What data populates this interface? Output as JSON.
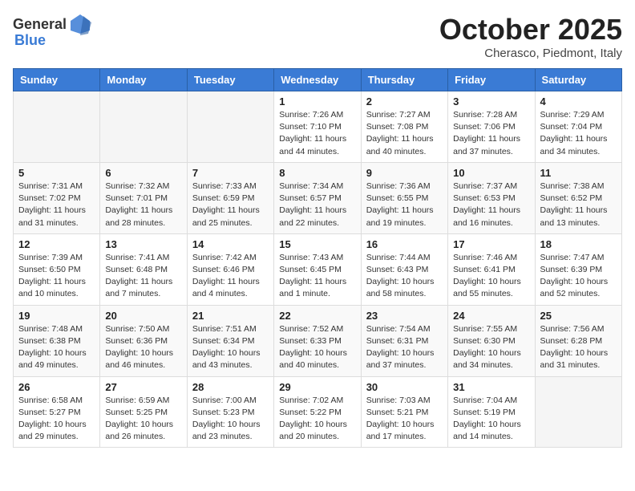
{
  "header": {
    "logo_general": "General",
    "logo_blue": "Blue",
    "month_title": "October 2025",
    "location": "Cherasco, Piedmont, Italy"
  },
  "weekdays": [
    "Sunday",
    "Monday",
    "Tuesday",
    "Wednesday",
    "Thursday",
    "Friday",
    "Saturday"
  ],
  "weeks": [
    [
      {
        "day": "",
        "detail": ""
      },
      {
        "day": "",
        "detail": ""
      },
      {
        "day": "",
        "detail": ""
      },
      {
        "day": "1",
        "detail": "Sunrise: 7:26 AM\nSunset: 7:10 PM\nDaylight: 11 hours\nand 44 minutes."
      },
      {
        "day": "2",
        "detail": "Sunrise: 7:27 AM\nSunset: 7:08 PM\nDaylight: 11 hours\nand 40 minutes."
      },
      {
        "day": "3",
        "detail": "Sunrise: 7:28 AM\nSunset: 7:06 PM\nDaylight: 11 hours\nand 37 minutes."
      },
      {
        "day": "4",
        "detail": "Sunrise: 7:29 AM\nSunset: 7:04 PM\nDaylight: 11 hours\nand 34 minutes."
      }
    ],
    [
      {
        "day": "5",
        "detail": "Sunrise: 7:31 AM\nSunset: 7:02 PM\nDaylight: 11 hours\nand 31 minutes."
      },
      {
        "day": "6",
        "detail": "Sunrise: 7:32 AM\nSunset: 7:01 PM\nDaylight: 11 hours\nand 28 minutes."
      },
      {
        "day": "7",
        "detail": "Sunrise: 7:33 AM\nSunset: 6:59 PM\nDaylight: 11 hours\nand 25 minutes."
      },
      {
        "day": "8",
        "detail": "Sunrise: 7:34 AM\nSunset: 6:57 PM\nDaylight: 11 hours\nand 22 minutes."
      },
      {
        "day": "9",
        "detail": "Sunrise: 7:36 AM\nSunset: 6:55 PM\nDaylight: 11 hours\nand 19 minutes."
      },
      {
        "day": "10",
        "detail": "Sunrise: 7:37 AM\nSunset: 6:53 PM\nDaylight: 11 hours\nand 16 minutes."
      },
      {
        "day": "11",
        "detail": "Sunrise: 7:38 AM\nSunset: 6:52 PM\nDaylight: 11 hours\nand 13 minutes."
      }
    ],
    [
      {
        "day": "12",
        "detail": "Sunrise: 7:39 AM\nSunset: 6:50 PM\nDaylight: 11 hours\nand 10 minutes."
      },
      {
        "day": "13",
        "detail": "Sunrise: 7:41 AM\nSunset: 6:48 PM\nDaylight: 11 hours\nand 7 minutes."
      },
      {
        "day": "14",
        "detail": "Sunrise: 7:42 AM\nSunset: 6:46 PM\nDaylight: 11 hours\nand 4 minutes."
      },
      {
        "day": "15",
        "detail": "Sunrise: 7:43 AM\nSunset: 6:45 PM\nDaylight: 11 hours\nand 1 minute."
      },
      {
        "day": "16",
        "detail": "Sunrise: 7:44 AM\nSunset: 6:43 PM\nDaylight: 10 hours\nand 58 minutes."
      },
      {
        "day": "17",
        "detail": "Sunrise: 7:46 AM\nSunset: 6:41 PM\nDaylight: 10 hours\nand 55 minutes."
      },
      {
        "day": "18",
        "detail": "Sunrise: 7:47 AM\nSunset: 6:39 PM\nDaylight: 10 hours\nand 52 minutes."
      }
    ],
    [
      {
        "day": "19",
        "detail": "Sunrise: 7:48 AM\nSunset: 6:38 PM\nDaylight: 10 hours\nand 49 minutes."
      },
      {
        "day": "20",
        "detail": "Sunrise: 7:50 AM\nSunset: 6:36 PM\nDaylight: 10 hours\nand 46 minutes."
      },
      {
        "day": "21",
        "detail": "Sunrise: 7:51 AM\nSunset: 6:34 PM\nDaylight: 10 hours\nand 43 minutes."
      },
      {
        "day": "22",
        "detail": "Sunrise: 7:52 AM\nSunset: 6:33 PM\nDaylight: 10 hours\nand 40 minutes."
      },
      {
        "day": "23",
        "detail": "Sunrise: 7:54 AM\nSunset: 6:31 PM\nDaylight: 10 hours\nand 37 minutes."
      },
      {
        "day": "24",
        "detail": "Sunrise: 7:55 AM\nSunset: 6:30 PM\nDaylight: 10 hours\nand 34 minutes."
      },
      {
        "day": "25",
        "detail": "Sunrise: 7:56 AM\nSunset: 6:28 PM\nDaylight: 10 hours\nand 31 minutes."
      }
    ],
    [
      {
        "day": "26",
        "detail": "Sunrise: 6:58 AM\nSunset: 5:27 PM\nDaylight: 10 hours\nand 29 minutes."
      },
      {
        "day": "27",
        "detail": "Sunrise: 6:59 AM\nSunset: 5:25 PM\nDaylight: 10 hours\nand 26 minutes."
      },
      {
        "day": "28",
        "detail": "Sunrise: 7:00 AM\nSunset: 5:23 PM\nDaylight: 10 hours\nand 23 minutes."
      },
      {
        "day": "29",
        "detail": "Sunrise: 7:02 AM\nSunset: 5:22 PM\nDaylight: 10 hours\nand 20 minutes."
      },
      {
        "day": "30",
        "detail": "Sunrise: 7:03 AM\nSunset: 5:21 PM\nDaylight: 10 hours\nand 17 minutes."
      },
      {
        "day": "31",
        "detail": "Sunrise: 7:04 AM\nSunset: 5:19 PM\nDaylight: 10 hours\nand 14 minutes."
      },
      {
        "day": "",
        "detail": ""
      }
    ]
  ]
}
